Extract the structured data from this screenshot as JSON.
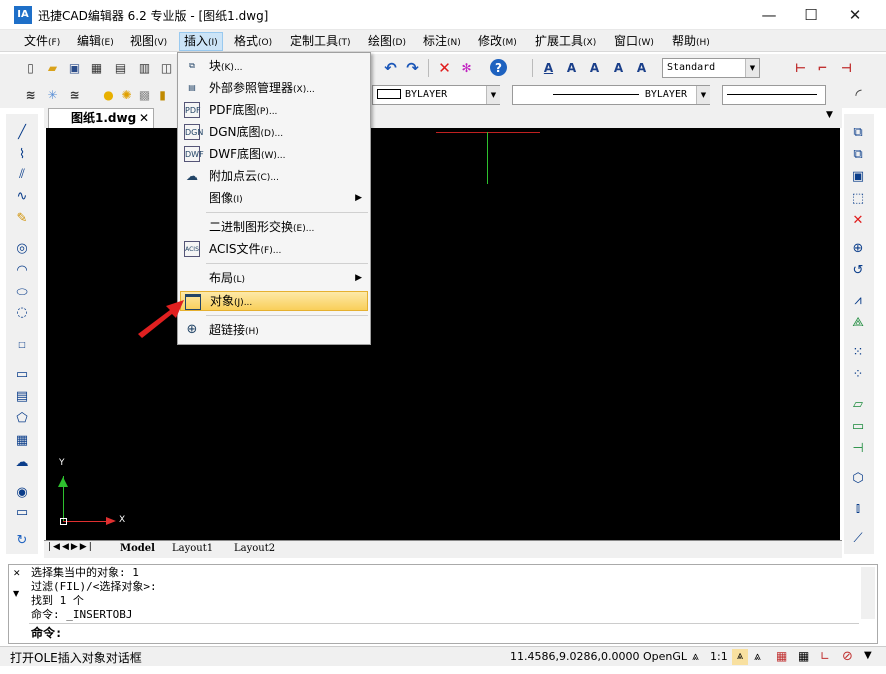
{
  "window": {
    "title": "迅捷CAD编辑器 6.2 专业版  - [图纸1.dwg]",
    "icon_label": "IA",
    "minimize": "—",
    "maximize": "☐",
    "close": "✕"
  },
  "menubar": [
    {
      "label": "文件",
      "acc": "(F)"
    },
    {
      "label": "编辑",
      "acc": "(E)"
    },
    {
      "label": "视图",
      "acc": "(V)"
    },
    {
      "label": "插入",
      "acc": "(I)"
    },
    {
      "label": "格式",
      "acc": "(O)"
    },
    {
      "label": "定制工具",
      "acc": "(T)"
    },
    {
      "label": "绘图",
      "acc": "(D)"
    },
    {
      "label": "标注",
      "acc": "(N)"
    },
    {
      "label": "修改",
      "acc": "(M)"
    },
    {
      "label": "扩展工具",
      "acc": "(X)"
    },
    {
      "label": "窗口",
      "acc": "(W)"
    },
    {
      "label": "帮助",
      "acc": "(H)"
    }
  ],
  "toolbar": {
    "text_style": "Standard",
    "layer_color": "BYLAYER",
    "linetype": "BYLAYER"
  },
  "insert_menu": [
    {
      "label": "块",
      "acc": "(K)...",
      "icon": "block-icon"
    },
    {
      "label": "外部参照管理器",
      "acc": "(X)...",
      "icon": "xref-icon"
    },
    {
      "label": "PDF底图",
      "acc": "(P)...",
      "icon": "pdf-icon",
      "glyph": "PDF"
    },
    {
      "label": "DGN底图",
      "acc": "(D)...",
      "icon": "dgn-icon",
      "glyph": "DGN"
    },
    {
      "label": "DWF底图",
      "acc": "(W)...",
      "icon": "dwf-icon",
      "glyph": "DWF"
    },
    {
      "label": "附加点云",
      "acc": "(C)...",
      "icon": "point-cloud-icon"
    },
    {
      "label": "图像",
      "acc": "(I)",
      "icon": "",
      "submenu": true
    },
    {
      "label": "二进制图形交换",
      "acc": "(E)...",
      "icon": ""
    },
    {
      "label": "ACIS文件",
      "acc": "(F)...",
      "icon": "acis-icon",
      "glyph": "ACIS"
    },
    {
      "label": "布局",
      "acc": "(L)",
      "icon": "",
      "submenu": true
    },
    {
      "label": "对象",
      "acc": "(J)...",
      "icon": "ole-object-icon"
    },
    {
      "label": "超链接",
      "acc": "(H)",
      "icon": "hyperlink-icon"
    }
  ],
  "document": {
    "tab_label": "图纸1.dwg",
    "tab_close": "✕"
  },
  "ucs": {
    "x_label": "X",
    "y_label": "Y"
  },
  "layout_tabs": [
    "Model",
    "Layout1",
    "Layout2"
  ],
  "command_history": [
    "选择集当中的对象: 1",
    "过滤(FIL)/<选择对象>:",
    "找到 1 个",
    "命令: _INSERTOBJ"
  ],
  "command_prompt": "命令:",
  "status": {
    "message": "打开OLE插入对象对话框",
    "coords": "11.4586,9.0286,0.0000",
    "renderer": "OpenGL",
    "scale": "1:1"
  },
  "colors": {
    "canvas": "#000000",
    "menu_highlight": "#f9cf5a",
    "ucs": "#2ec02e",
    "ucs_x": "#e03030"
  }
}
